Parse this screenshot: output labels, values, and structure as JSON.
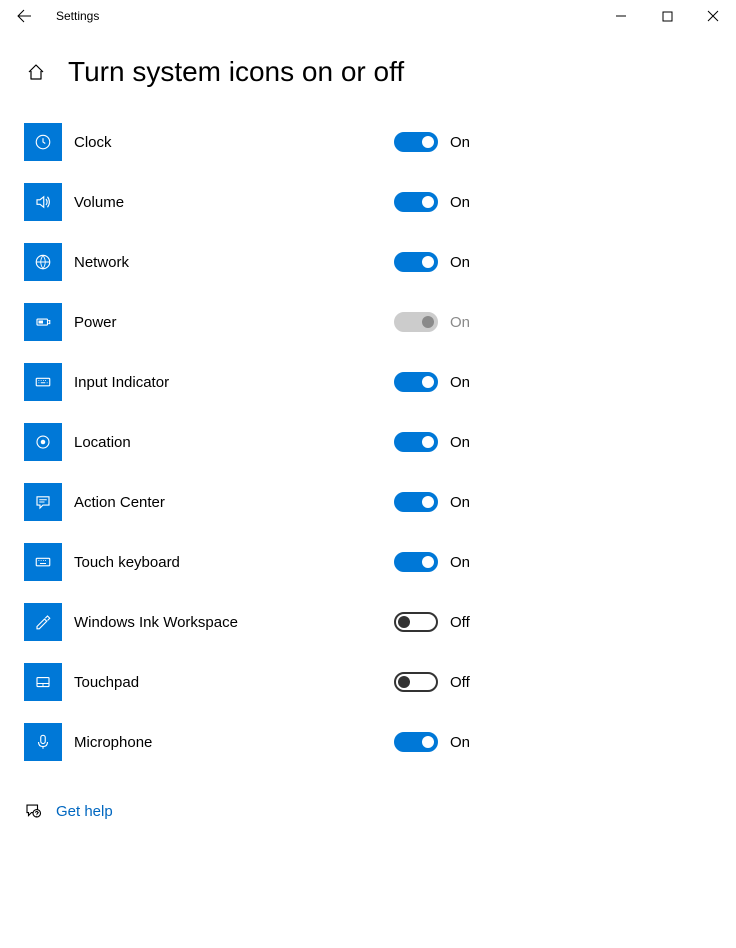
{
  "titlebar": {
    "app_name": "Settings"
  },
  "header": {
    "title": "Turn system icons on or off"
  },
  "items": [
    {
      "name": "clock",
      "label": "Clock",
      "state": "on",
      "state_label": "On"
    },
    {
      "name": "volume",
      "label": "Volume",
      "state": "on",
      "state_label": "On"
    },
    {
      "name": "network",
      "label": "Network",
      "state": "on",
      "state_label": "On"
    },
    {
      "name": "power",
      "label": "Power",
      "state": "disabled",
      "state_label": "On"
    },
    {
      "name": "input-indicator",
      "label": "Input Indicator",
      "state": "on",
      "state_label": "On"
    },
    {
      "name": "location",
      "label": "Location",
      "state": "on",
      "state_label": "On"
    },
    {
      "name": "action-center",
      "label": "Action Center",
      "state": "on",
      "state_label": "On"
    },
    {
      "name": "touch-keyboard",
      "label": "Touch keyboard",
      "state": "on",
      "state_label": "On"
    },
    {
      "name": "windows-ink",
      "label": "Windows Ink Workspace",
      "state": "off",
      "state_label": "Off"
    },
    {
      "name": "touchpad",
      "label": "Touchpad",
      "state": "off",
      "state_label": "Off"
    },
    {
      "name": "microphone",
      "label": "Microphone",
      "state": "on",
      "state_label": "On"
    }
  ],
  "help": {
    "label": "Get help"
  }
}
